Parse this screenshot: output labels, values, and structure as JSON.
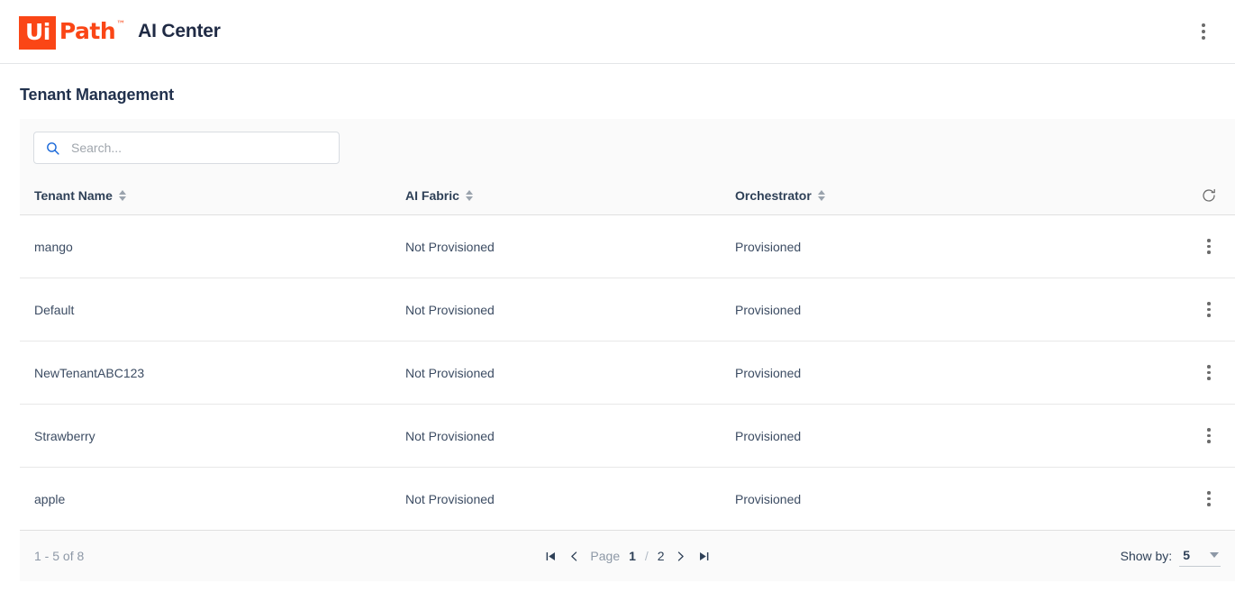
{
  "header": {
    "logo": {
      "badge_text": "Ui",
      "word_text": "Path",
      "tm": "™",
      "badge_color": "#fa4616",
      "word_color": "#fa4616"
    },
    "product_name": "AI Center",
    "overflow_menu_icon": "kebab-vertical-icon"
  },
  "page": {
    "title": "Tenant Management"
  },
  "search": {
    "placeholder": "Search...",
    "value": "",
    "icon": "search-icon",
    "icon_color": "#1565d8"
  },
  "table": {
    "columns": [
      {
        "label": "Tenant Name",
        "sortable": true
      },
      {
        "label": "AI Fabric",
        "sortable": true
      },
      {
        "label": "Orchestrator",
        "sortable": true
      }
    ],
    "refresh_icon": "refresh-icon",
    "row_menu_icon": "kebab-vertical-icon",
    "rows": [
      {
        "name": "mango",
        "ai_fabric": "Not Provisioned",
        "orchestrator": "Provisioned"
      },
      {
        "name": "Default",
        "ai_fabric": "Not Provisioned",
        "orchestrator": "Provisioned"
      },
      {
        "name": "NewTenantABC123",
        "ai_fabric": "Not Provisioned",
        "orchestrator": "Provisioned"
      },
      {
        "name": "Strawberry",
        "ai_fabric": "Not Provisioned",
        "orchestrator": "Provisioned"
      },
      {
        "name": "apple",
        "ai_fabric": "Not Provisioned",
        "orchestrator": "Provisioned"
      }
    ]
  },
  "footer": {
    "range_text": "1 - 5 of 8",
    "page_label": "Page",
    "current_page": "1",
    "page_separator": "/",
    "total_pages": "2",
    "first_page_icon": "first-page-icon",
    "prev_page_icon": "chevron-left-icon",
    "next_page_icon": "chevron-right-icon",
    "last_page_icon": "last-page-icon",
    "show_by_label": "Show by:",
    "show_by_value": "5",
    "show_by_caret_icon": "chevron-down-icon"
  }
}
